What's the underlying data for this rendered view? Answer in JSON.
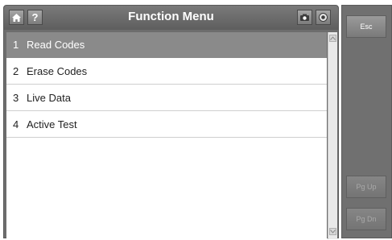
{
  "window": {
    "title": "Function Menu",
    "home_icon": "home-icon",
    "help_label": "?",
    "camera_icon": "camera-icon",
    "record_icon": "record-icon"
  },
  "menu": {
    "items": [
      {
        "num": "1",
        "label": "Read Codes",
        "selected": true
      },
      {
        "num": "2",
        "label": "Erase Codes",
        "selected": false
      },
      {
        "num": "3",
        "label": "Live Data",
        "selected": false
      },
      {
        "num": "4",
        "label": "Active Test",
        "selected": false
      }
    ]
  },
  "side": {
    "esc_label": "Esc",
    "pgup_label": "Pg Up",
    "pgdn_label": "Pg Dn"
  },
  "colors": {
    "selected_row": "#8a8a8a",
    "panel_gray": "#6d6d6d"
  }
}
